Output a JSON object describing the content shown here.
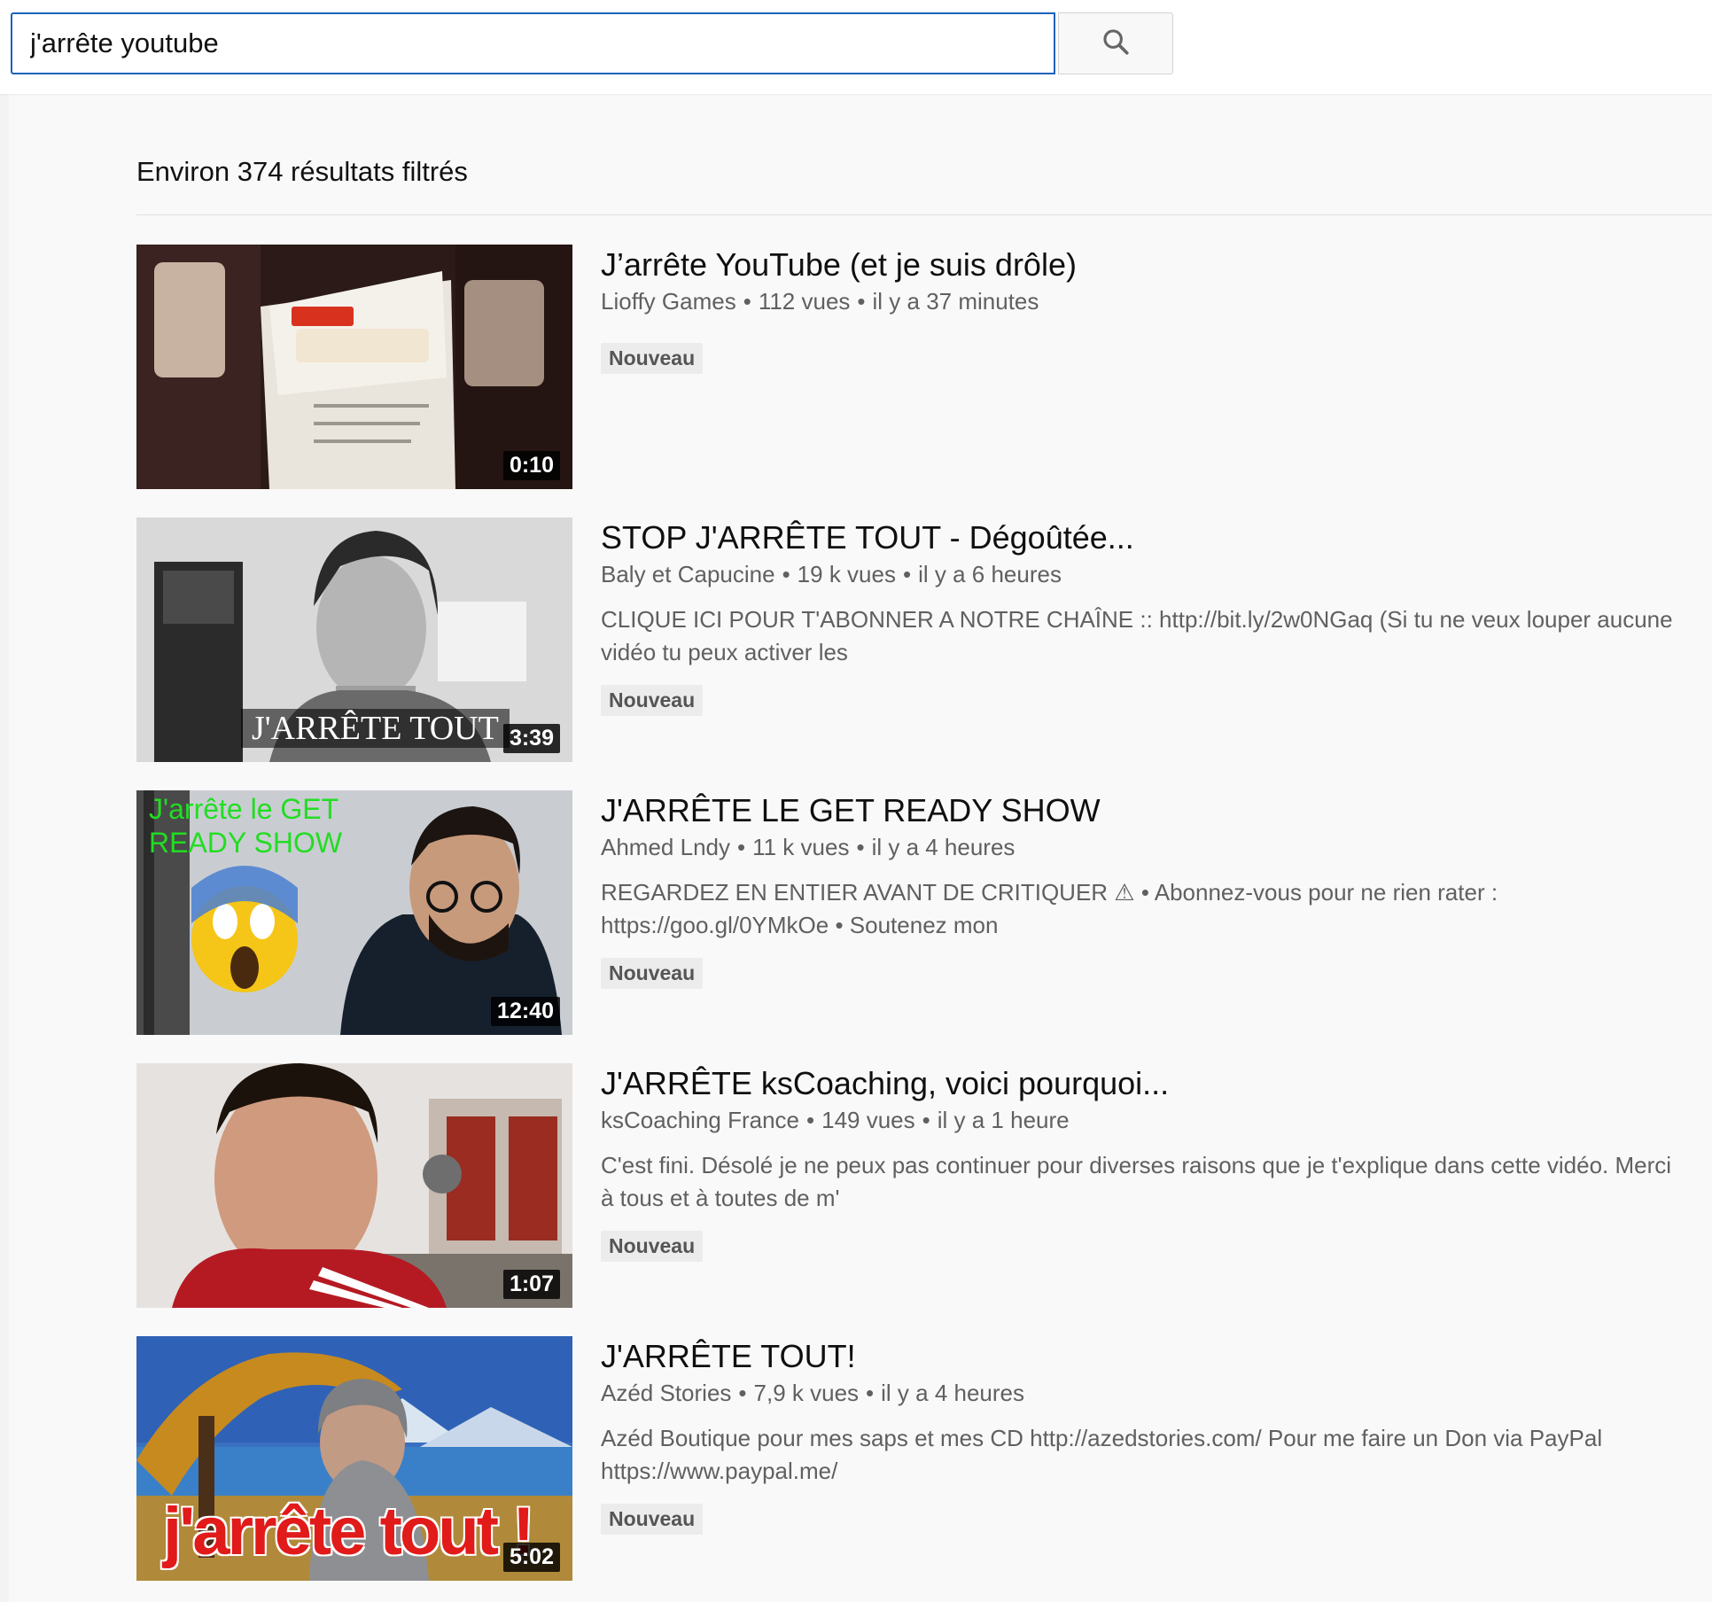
{
  "search": {
    "query": "j'arrête youtube",
    "icon": "search-icon"
  },
  "results_label": "Environ 374 résultats filtrés",
  "videos": [
    {
      "title": "J’arrête YouTube (et je suis drôle)",
      "channel": "Lioffy Games",
      "views": "112 vues",
      "age": "il y a 37 minutes",
      "description": "",
      "badge": "Nouveau",
      "duration": "0:10"
    },
    {
      "title": "STOP J'ARRÊTE TOUT - Dégoûtée...",
      "channel": "Baly et Capucine",
      "views": "19 k vues",
      "age": "il y a 6 heures",
      "description": "CLIQUE ICI POUR T'ABONNER A NOTRE CHAÎNE :: http://bit.ly/2w0NGaq (Si tu ne veux louper aucune vidéo tu peux activer les",
      "badge": "Nouveau",
      "duration": "3:39",
      "thumb_text": "J'ARRÊTE TOUT"
    },
    {
      "title": "J'ARRÊTE LE GET READY SHOW",
      "channel": "Ahmed Lndy",
      "views": "11 k vues",
      "age": "il y a 4 heures",
      "description": "REGARDEZ EN ENTIER AVANT DE CRITIQUER ⚠ • Abonnez-vous pour ne rien rater : https://goo.gl/0YMkOe • Soutenez mon",
      "badge": "Nouveau",
      "duration": "12:40",
      "thumb_text_line1": "J'arrête le GET",
      "thumb_text_line2": "READY SHOW"
    },
    {
      "title": "J'ARRÊTE ksCoaching, voici pourquoi...",
      "channel": "ksCoaching France",
      "views": "149 vues",
      "age": "il y a 1 heure",
      "description": "C'est fini. Désolé je ne peux pas continuer pour diverses raisons que je t'explique dans cette vidéo. Merci à tous et à toutes de m'",
      "badge": "Nouveau",
      "duration": "1:07"
    },
    {
      "title": "J'ARRÊTE TOUT!",
      "channel": "Azéd Stories",
      "views": "7,9 k vues",
      "age": "il y a 4 heures",
      "description": "Azéd Boutique pour mes saps et mes CD http://azedstories.com/ Pour me faire un Don via PayPal https://www.paypal.me/",
      "badge": "Nouveau",
      "duration": "5:02",
      "thumb_text": "j'arrête tout !"
    }
  ],
  "colors": {
    "accent_border": "#1c62b9",
    "page_bg": "#f9f9f9",
    "meta_text": "#606060",
    "badge_bg": "#ececec"
  }
}
